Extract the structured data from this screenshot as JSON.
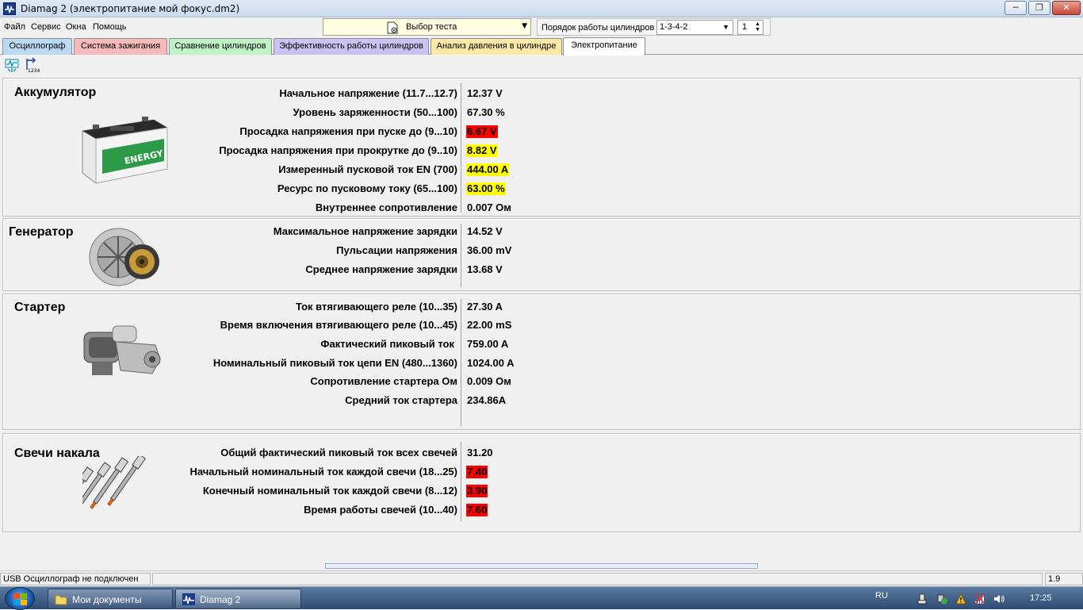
{
  "window": {
    "title": "Diamag 2 (электропитание мой фокус.dm2)",
    "minimize": "─",
    "maximize": "❐",
    "close": "✕"
  },
  "menu": [
    "Файл",
    "Сервис",
    "Окна",
    "Помощь"
  ],
  "test_select": {
    "label": "Выбор теста"
  },
  "cylinder_order": {
    "label": "Порядок работы цилиндров",
    "value": "1-3-4-2",
    "spin_value": "1"
  },
  "tabs": [
    {
      "label": "Осциллограф",
      "color": "#b9d9f5"
    },
    {
      "label": "Система зажигания",
      "color": "#f7b9b9"
    },
    {
      "label": "Сравнение цилиндров",
      "color": "#bff2c5"
    },
    {
      "label": "Эффективность работы цилиндров",
      "color": "#c9c2f2"
    },
    {
      "label": "Анализ давления в цилиндре",
      "color": "#fde8a6"
    },
    {
      "label": "Электропитание",
      "color": "#ffffff",
      "active": true
    }
  ],
  "sections": [
    {
      "title": "Аккумулятор",
      "image": "car-battery",
      "image_label": "ENERGY",
      "rows": [
        {
          "label": "Начальное напряжение (11.7...12.7)",
          "value": "12.37 V",
          "status": "normal"
        },
        {
          "label": "Уровень заряженности (50...100)",
          "value": "67.30 %",
          "status": "normal"
        },
        {
          "label": "Просадка напряжения при пуске до (9...10)",
          "value": "6.67 V",
          "status": "red"
        },
        {
          "label": "Просадка напряжения при прокрутке до  (9..10)",
          "value": "8.82 V",
          "status": "yellow"
        },
        {
          "label": "Измеренный пусковой ток  EN (700)",
          "value": "444.00 A",
          "status": "yellow"
        },
        {
          "label": "Ресурс по пусковому току (65...100)",
          "value": "63.00 %",
          "status": "yellow"
        },
        {
          "label": "Внутреннее сопротивление",
          "value": "0.007 Ом",
          "status": "normal"
        }
      ]
    },
    {
      "title": "Генератор",
      "image": "alternator",
      "rows": [
        {
          "label": "Максимальное напряжение зарядки",
          "value": "14.52 V",
          "status": "normal"
        },
        {
          "label": "Пульсации напряжения",
          "value": "36.00 mV",
          "status": "normal"
        },
        {
          "label": "Среднее напряжение зарядки",
          "value": "13.68 V",
          "status": "normal"
        }
      ]
    },
    {
      "title": "Стартер",
      "image": "starter-motor",
      "rows": [
        {
          "label": "Ток втягивающего реле (10...35)",
          "value": "27.30 A",
          "status": "normal"
        },
        {
          "label": "Время включения втягивающего реле (10...45)",
          "value": "22.00 mS",
          "status": "normal"
        },
        {
          "label": "Фактический пиковый ток",
          "value": "759.00 A",
          "status": "normal"
        },
        {
          "label": "Номинальный пиковый ток цепи EN (480...1360)",
          "value": "1024.00 A",
          "status": "normal"
        },
        {
          "label": "Сопротивление стартера Ом",
          "value": "0.009 Ом",
          "status": "normal"
        },
        {
          "label": "Средний ток стартера",
          "value": "234.86A",
          "status": "normal"
        }
      ]
    },
    {
      "title": "Свечи накала",
      "image": "glow-plugs",
      "rows": [
        {
          "label": "Общий фактический пиковый ток всех свечей",
          "value": "31.20",
          "status": "normal"
        },
        {
          "label": "Начальный номинальный ток каждой свечи (18...25)",
          "value": "7.40",
          "status": "red"
        },
        {
          "label": "Конечный номинальный ток каждой свечи (8...12)",
          "value": "3.90",
          "status": "red"
        },
        {
          "label": "Время работы свечей (10...40)",
          "value": "7.60",
          "status": "red"
        }
      ]
    }
  ],
  "statusbar": {
    "left": "USB Осциллограф не подключен",
    "right": "1.9"
  },
  "taskbar": {
    "buttons": [
      "Мои документы",
      "Diamag 2"
    ],
    "lang": "RU",
    "time": "17:25"
  }
}
